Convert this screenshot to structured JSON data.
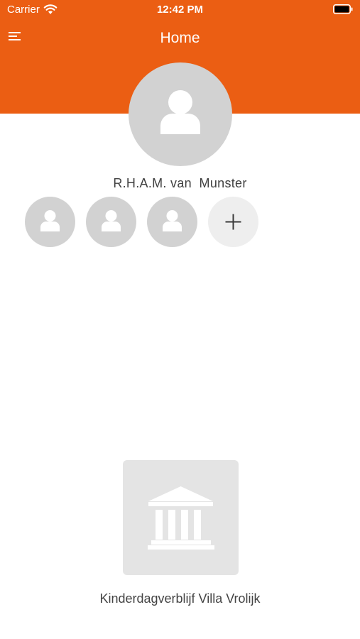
{
  "status_bar": {
    "carrier": "Carrier",
    "time": "12:42 PM"
  },
  "header": {
    "title": "Home",
    "background_color": "#EB5E13"
  },
  "user": {
    "name": "R.H.A.M. van  Munster"
  },
  "children": [
    {
      "icon": "person-icon"
    },
    {
      "icon": "person-icon"
    },
    {
      "icon": "person-icon"
    }
  ],
  "add_child": {
    "icon": "plus-icon"
  },
  "organization": {
    "name": "Kinderdagverblijf Villa Vrolijk",
    "icon": "building-icon"
  }
}
